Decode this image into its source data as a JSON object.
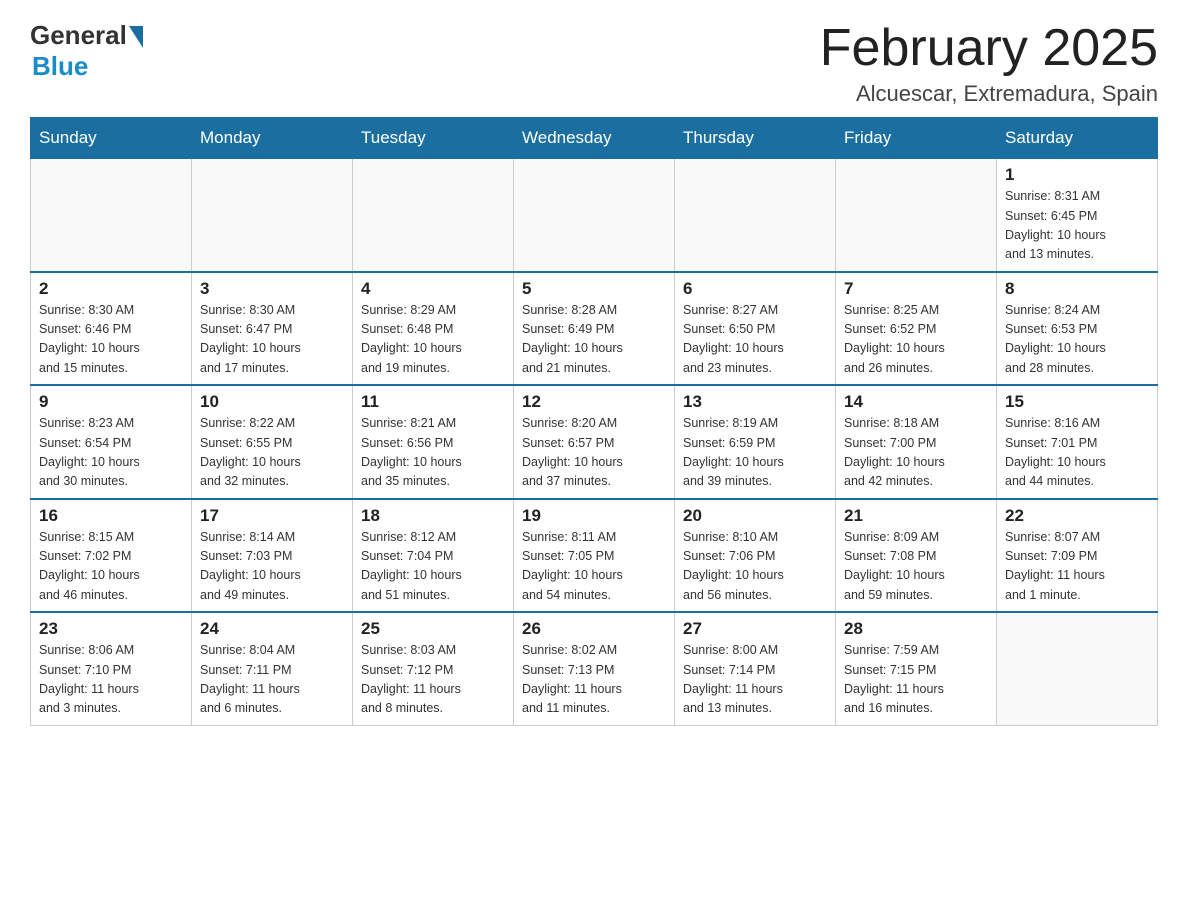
{
  "header": {
    "logo_general": "General",
    "logo_blue": "Blue",
    "month": "February 2025",
    "location": "Alcuescar, Extremadura, Spain"
  },
  "weekdays": [
    "Sunday",
    "Monday",
    "Tuesday",
    "Wednesday",
    "Thursday",
    "Friday",
    "Saturday"
  ],
  "weeks": [
    [
      {
        "day": "",
        "info": ""
      },
      {
        "day": "",
        "info": ""
      },
      {
        "day": "",
        "info": ""
      },
      {
        "day": "",
        "info": ""
      },
      {
        "day": "",
        "info": ""
      },
      {
        "day": "",
        "info": ""
      },
      {
        "day": "1",
        "info": "Sunrise: 8:31 AM\nSunset: 6:45 PM\nDaylight: 10 hours\nand 13 minutes."
      }
    ],
    [
      {
        "day": "2",
        "info": "Sunrise: 8:30 AM\nSunset: 6:46 PM\nDaylight: 10 hours\nand 15 minutes."
      },
      {
        "day": "3",
        "info": "Sunrise: 8:30 AM\nSunset: 6:47 PM\nDaylight: 10 hours\nand 17 minutes."
      },
      {
        "day": "4",
        "info": "Sunrise: 8:29 AM\nSunset: 6:48 PM\nDaylight: 10 hours\nand 19 minutes."
      },
      {
        "day": "5",
        "info": "Sunrise: 8:28 AM\nSunset: 6:49 PM\nDaylight: 10 hours\nand 21 minutes."
      },
      {
        "day": "6",
        "info": "Sunrise: 8:27 AM\nSunset: 6:50 PM\nDaylight: 10 hours\nand 23 minutes."
      },
      {
        "day": "7",
        "info": "Sunrise: 8:25 AM\nSunset: 6:52 PM\nDaylight: 10 hours\nand 26 minutes."
      },
      {
        "day": "8",
        "info": "Sunrise: 8:24 AM\nSunset: 6:53 PM\nDaylight: 10 hours\nand 28 minutes."
      }
    ],
    [
      {
        "day": "9",
        "info": "Sunrise: 8:23 AM\nSunset: 6:54 PM\nDaylight: 10 hours\nand 30 minutes."
      },
      {
        "day": "10",
        "info": "Sunrise: 8:22 AM\nSunset: 6:55 PM\nDaylight: 10 hours\nand 32 minutes."
      },
      {
        "day": "11",
        "info": "Sunrise: 8:21 AM\nSunset: 6:56 PM\nDaylight: 10 hours\nand 35 minutes."
      },
      {
        "day": "12",
        "info": "Sunrise: 8:20 AM\nSunset: 6:57 PM\nDaylight: 10 hours\nand 37 minutes."
      },
      {
        "day": "13",
        "info": "Sunrise: 8:19 AM\nSunset: 6:59 PM\nDaylight: 10 hours\nand 39 minutes."
      },
      {
        "day": "14",
        "info": "Sunrise: 8:18 AM\nSunset: 7:00 PM\nDaylight: 10 hours\nand 42 minutes."
      },
      {
        "day": "15",
        "info": "Sunrise: 8:16 AM\nSunset: 7:01 PM\nDaylight: 10 hours\nand 44 minutes."
      }
    ],
    [
      {
        "day": "16",
        "info": "Sunrise: 8:15 AM\nSunset: 7:02 PM\nDaylight: 10 hours\nand 46 minutes."
      },
      {
        "day": "17",
        "info": "Sunrise: 8:14 AM\nSunset: 7:03 PM\nDaylight: 10 hours\nand 49 minutes."
      },
      {
        "day": "18",
        "info": "Sunrise: 8:12 AM\nSunset: 7:04 PM\nDaylight: 10 hours\nand 51 minutes."
      },
      {
        "day": "19",
        "info": "Sunrise: 8:11 AM\nSunset: 7:05 PM\nDaylight: 10 hours\nand 54 minutes."
      },
      {
        "day": "20",
        "info": "Sunrise: 8:10 AM\nSunset: 7:06 PM\nDaylight: 10 hours\nand 56 minutes."
      },
      {
        "day": "21",
        "info": "Sunrise: 8:09 AM\nSunset: 7:08 PM\nDaylight: 10 hours\nand 59 minutes."
      },
      {
        "day": "22",
        "info": "Sunrise: 8:07 AM\nSunset: 7:09 PM\nDaylight: 11 hours\nand 1 minute."
      }
    ],
    [
      {
        "day": "23",
        "info": "Sunrise: 8:06 AM\nSunset: 7:10 PM\nDaylight: 11 hours\nand 3 minutes."
      },
      {
        "day": "24",
        "info": "Sunrise: 8:04 AM\nSunset: 7:11 PM\nDaylight: 11 hours\nand 6 minutes."
      },
      {
        "day": "25",
        "info": "Sunrise: 8:03 AM\nSunset: 7:12 PM\nDaylight: 11 hours\nand 8 minutes."
      },
      {
        "day": "26",
        "info": "Sunrise: 8:02 AM\nSunset: 7:13 PM\nDaylight: 11 hours\nand 11 minutes."
      },
      {
        "day": "27",
        "info": "Sunrise: 8:00 AM\nSunset: 7:14 PM\nDaylight: 11 hours\nand 13 minutes."
      },
      {
        "day": "28",
        "info": "Sunrise: 7:59 AM\nSunset: 7:15 PM\nDaylight: 11 hours\nand 16 minutes."
      },
      {
        "day": "",
        "info": ""
      }
    ]
  ]
}
